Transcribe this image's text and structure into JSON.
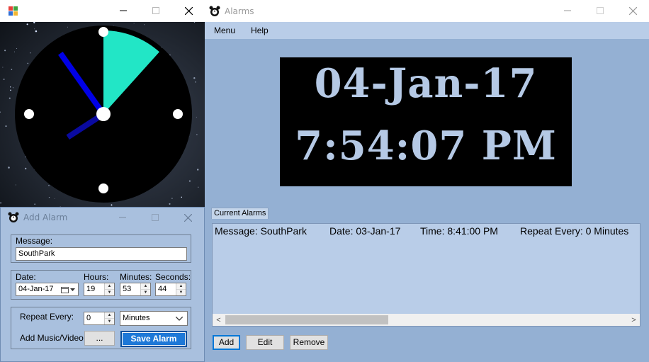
{
  "clock_window": {
    "title": "",
    "icon": "windows-form-icon"
  },
  "analog_clock": {
    "hour": 7,
    "minute": 54,
    "second": 7,
    "hand_colors": {
      "hour": "#0a0aa0",
      "minute": "#0000e6",
      "face": "#000000",
      "sweep": "#22e6c6",
      "markers": "#ffffff"
    }
  },
  "add_alarm": {
    "title": "Add Alarm",
    "message_label": "Message:",
    "message_value": "SouthPark",
    "date_label": "Date:",
    "date_value": "04-Jan-17",
    "hours_label": "Hours:",
    "hours_value": "19",
    "minutes_label": "Minutes:",
    "minutes_value": "53",
    "seconds_label": "Seconds:",
    "seconds_value": "44",
    "repeat_label": "Repeat Every:",
    "repeat_value": "0",
    "repeat_unit": "Minutes",
    "music_label": "Add Music/Video:",
    "browse_label": "...",
    "save_label": "Save Alarm"
  },
  "main": {
    "title": "Alarms",
    "menu": [
      "Menu",
      "Help"
    ],
    "date_display": "04-Jan-17",
    "time_display": "7:54:07 PM",
    "current_alarms_label": "Current Alarms",
    "alarms": [
      {
        "message": "Message: SouthPark",
        "date": "Date: 03-Jan-17",
        "time": "Time: 8:41:00 PM",
        "repeat": "Repeat Every: 0 Minutes"
      }
    ],
    "buttons": {
      "add": "Add",
      "edit": "Edit",
      "remove": "Remove"
    }
  },
  "colors": {
    "main_bg": "#94b0d3",
    "panel_bg": "#b9cde8",
    "digital_text": "#b5c9e5",
    "primary_button": "#1e78d7"
  }
}
